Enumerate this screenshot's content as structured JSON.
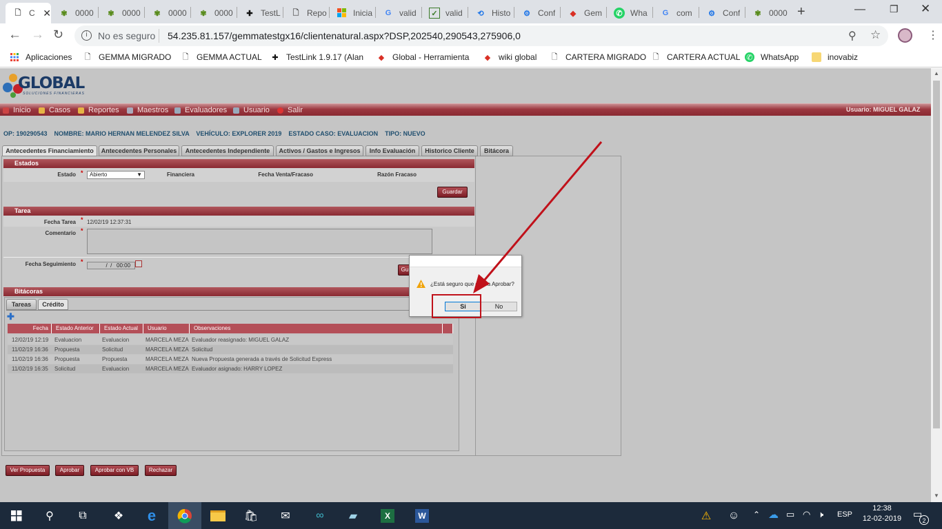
{
  "browser": {
    "tabs": [
      {
        "label": "C",
        "icon": "page-icon"
      },
      {
        "label": "0000",
        "icon": "bug-icon"
      },
      {
        "label": "0000",
        "icon": "bug-icon"
      },
      {
        "label": "0000",
        "icon": "bug-icon"
      },
      {
        "label": "0000",
        "icon": "bug-icon"
      },
      {
        "label": "TestL",
        "icon": "testlink-icon"
      },
      {
        "label": "Repo",
        "icon": "page-icon"
      },
      {
        "label": "Inicia",
        "icon": "windows-icon"
      },
      {
        "label": "valid",
        "icon": "google-icon"
      },
      {
        "label": "valid",
        "icon": "check-icon"
      },
      {
        "label": "Histo",
        "icon": "history-icon"
      },
      {
        "label": "Conf",
        "icon": "gear-icon"
      },
      {
        "label": "Gem",
        "icon": "global-icon"
      },
      {
        "label": "Wha",
        "icon": "whatsapp-icon"
      },
      {
        "label": "com",
        "icon": "google-icon"
      },
      {
        "label": "Conf",
        "icon": "gear-icon"
      },
      {
        "label": "0000",
        "icon": "bug-icon"
      }
    ],
    "security": "No es seguro",
    "url": "54.235.81.157/gemmatestgx16/clientenatural.aspx?DSP,202540,290543,275906,0",
    "bookmarks": [
      {
        "label": "Aplicaciones",
        "icon": "apps-icon"
      },
      {
        "label": "GEMMA MIGRADO",
        "icon": "page-icon"
      },
      {
        "label": "GEMMA ACTUAL",
        "icon": "page-icon"
      },
      {
        "label": "TestLink 1.9.17 (Alan",
        "icon": "testlink-icon"
      },
      {
        "label": "Global - Herramienta",
        "icon": "global-icon"
      },
      {
        "label": "wiki global",
        "icon": "global-icon"
      },
      {
        "label": "CARTERA MIGRADO",
        "icon": "page-icon"
      },
      {
        "label": "CARTERA ACTUAL",
        "icon": "page-icon"
      },
      {
        "label": "WhatsApp",
        "icon": "whatsapp-icon"
      },
      {
        "label": "inovabiz",
        "icon": "folder-icon"
      }
    ]
  },
  "app": {
    "logo_text": "GLOBAL",
    "logo_sub": "SOLUCIONES FINANCIERAS",
    "menu": [
      "Inicio",
      "Casos",
      "Reportes",
      "Maestros",
      "Evaluadores",
      "Usuario",
      "Salir"
    ],
    "user_label": "Usuario:  MIGUEL GALAZ",
    "summary": "OP: 190290543    NOMBRE: MARIO HERNAN MELENDEZ SILVA    VEHÍCULO: EXPLORER 2019    ESTADO CASO: EVALUACION    TIPO: NUEVO",
    "tabs": [
      "Antecedentes Financiamiento",
      "Antecedentes Personales",
      "Antecedentes Independiente",
      "Activos / Gastos e Ingresos",
      "Info Evaluación",
      "Historico Cliente",
      "Bitácora"
    ],
    "estados": {
      "title": "Estados",
      "estado_label": "Estado",
      "estado_value": "Abierto",
      "financiera_label": "Financiera",
      "fecha_venta_label": "Fecha Venta/Fracaso",
      "razon_label": "Razón Fracaso",
      "save": "Guardar"
    },
    "tarea": {
      "title": "Tarea",
      "fecha_label": "Fecha Tarea",
      "fecha_value": "12/02/19 12:37:31",
      "comentario_label": "Comentario",
      "seguimiento_label": "Fecha Seguimiento",
      "seguimiento_value": "  /  /   00:00",
      "save_partial": "Gu"
    },
    "bitacoras": {
      "title": "Bitácoras",
      "subtabs": [
        "Tareas",
        "Crédito"
      ],
      "columns": [
        "Fecha",
        "Estado Anterior",
        "Estado Actual",
        "Usuario",
        "Observaciones"
      ],
      "rows": [
        [
          "12/02/19 12:19",
          "Evaluacion",
          "Evaluacion",
          "MARCELA MEZA",
          "Evaluador reasignado: MIGUEL GALAZ"
        ],
        [
          "11/02/19 16:36",
          "Propuesta",
          "Solicitud",
          "MARCELA MEZA",
          "Solicitud"
        ],
        [
          "11/02/19 16:36",
          "Propuesta",
          "Propuesta",
          "MARCELA MEZA",
          "Nueva Propuesta generada a través de Solicitud Express"
        ],
        [
          "11/02/19 16:35",
          "Solicitud",
          "Evaluacion",
          "MARCELA MEZA",
          "Evaluador asignado: HARRY LOPEZ"
        ]
      ]
    },
    "bottom_buttons": [
      "Ver Propuesta",
      "Aprobar",
      "Aprobar con VB",
      "Rechazar"
    ]
  },
  "dialog": {
    "message": "¿Está seguro que desea Aprobar?",
    "yes": "Si",
    "no": "No"
  },
  "taskbar": {
    "language": "ESP",
    "time": "12:38",
    "date": "12-02-2019",
    "notifications": "2"
  },
  "colors": {
    "accent": "#8a2a32",
    "annotation": "#c0111a"
  }
}
